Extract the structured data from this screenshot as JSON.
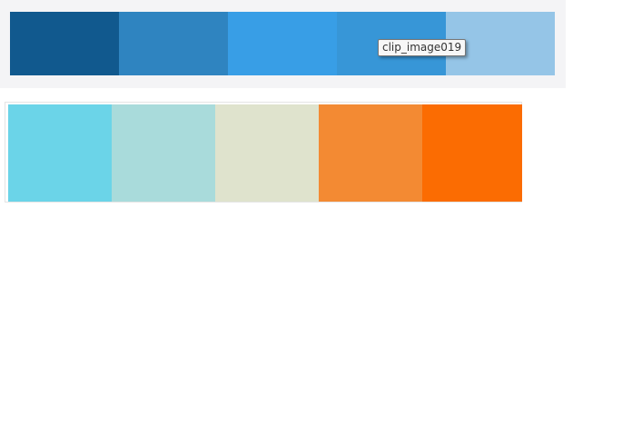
{
  "tooltip": {
    "text": "clip_image019"
  },
  "palettes": {
    "top": {
      "colors": [
        "#11598e",
        "#2f84c0",
        "#389ee6",
        "#3796d7",
        "#95c5e7"
      ]
    },
    "bottom": {
      "colors": [
        "#6bd4e8",
        "#a9dbdb",
        "#dfe3cd",
        "#f38a33",
        "#fb6c02"
      ]
    }
  }
}
